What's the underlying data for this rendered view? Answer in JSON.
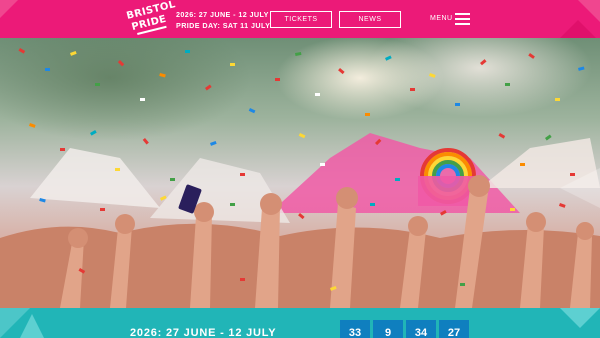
{
  "header": {
    "logo": {
      "line1": "BRISTOL",
      "line2": "PRIDE"
    },
    "dates": {
      "festival": "2026: 27 JUNE - 12 JULY",
      "pride_day": "PRIDE DAY: SAT 11 JULY"
    },
    "tickets_label": "TICKETS",
    "news_label": "NEWS",
    "menu_label": "MENU",
    "menu_icon": "hamburger-icon"
  },
  "hero": {
    "image": "crowd-with-confetti-photo"
  },
  "countdown_band": {
    "dates_text": "2026: 27 JUNE - 12 JULY",
    "values": [
      "33",
      "9",
      "34",
      "27"
    ]
  },
  "colors": {
    "header_pink": "#ec1a78",
    "band_teal": "#21b5b7",
    "countdown_blue": "#0f7fbf"
  }
}
